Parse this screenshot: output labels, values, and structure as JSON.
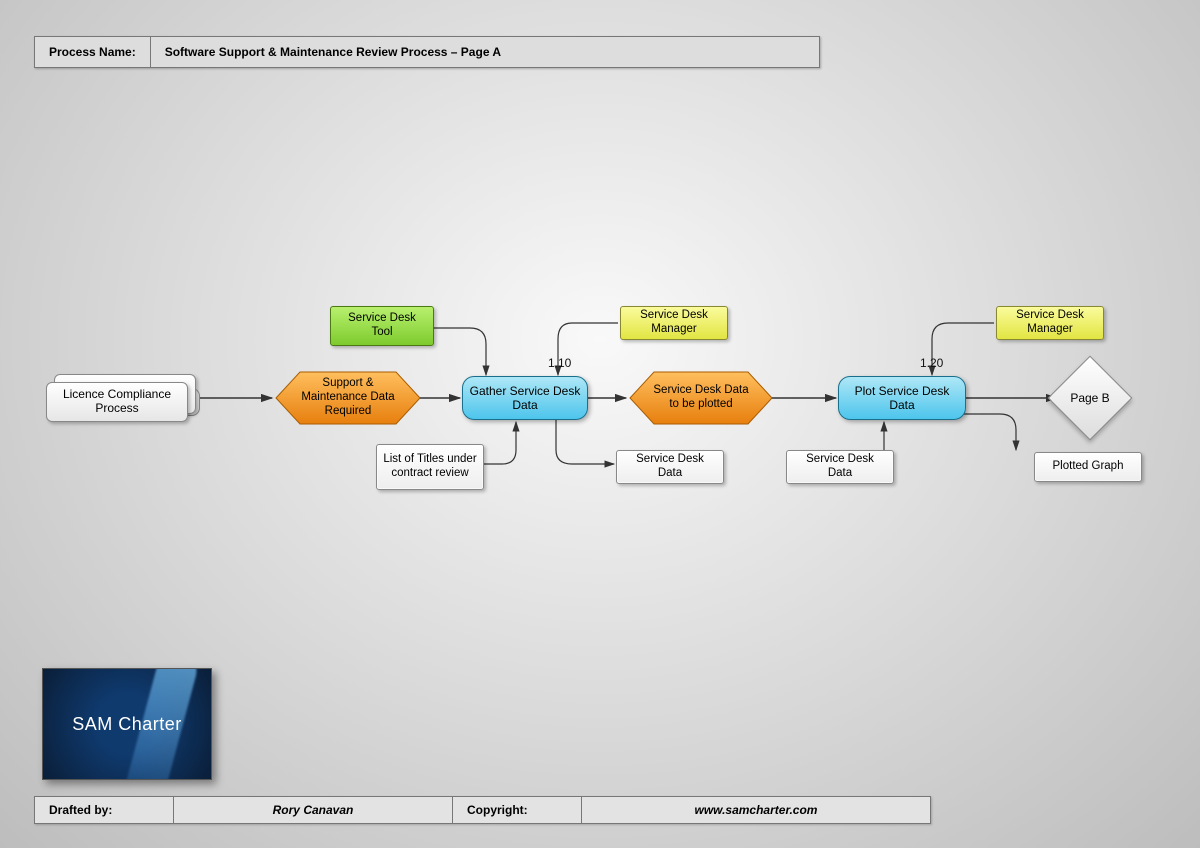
{
  "header": {
    "label": "Process Name:",
    "value": "Software Support & Maintenance Review Process – Page A"
  },
  "start": {
    "label": "Licence Compliance Process"
  },
  "hex1": {
    "label": "Support & Maintenance Data Required"
  },
  "proc1": {
    "num": "1.10",
    "label": "Gather Service Desk Data"
  },
  "hex2": {
    "label": "Service Desk Data to be plotted"
  },
  "proc2": {
    "num": "1.20",
    "label": "Plot Service Desk Data"
  },
  "end": {
    "label": "Page B"
  },
  "tool": {
    "label": "Service Desk Tool"
  },
  "mgr1": {
    "label": "Service Desk Manager"
  },
  "mgr2": {
    "label": "Service Desk Manager"
  },
  "in_list": {
    "label": "List of Titles under contract review"
  },
  "out_data1": {
    "label": "Service Desk Data"
  },
  "in_data2": {
    "label": "Service Desk Data"
  },
  "out_graph": {
    "label": "Plotted Graph"
  },
  "logo": {
    "text": "SAM Charter"
  },
  "footer": {
    "drafted_label": "Drafted by:",
    "drafted_value": "Rory Canavan",
    "copy_label": "Copyright:",
    "copy_value": "www.samcharter.com"
  },
  "colors": {
    "hex_fill": "#f0951f",
    "hex_stroke": "#a85c00"
  }
}
